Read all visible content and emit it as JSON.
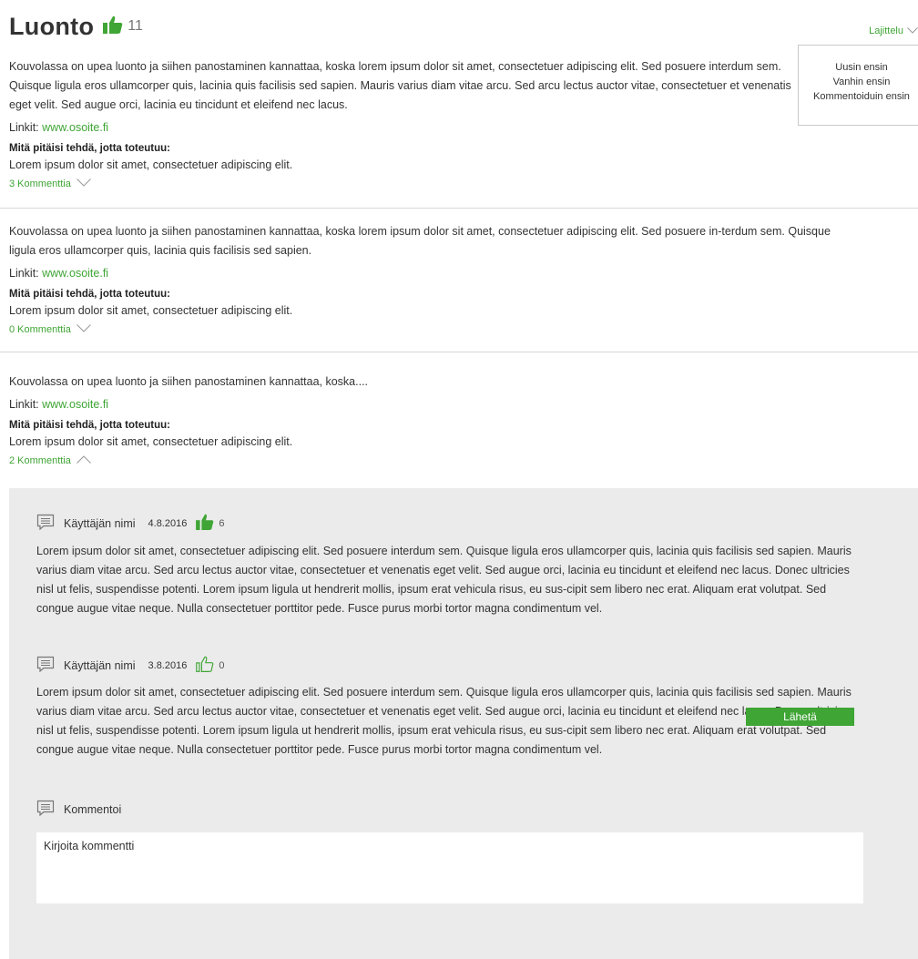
{
  "header": {
    "title": "Luonto",
    "likes": "11"
  },
  "sort": {
    "label": "Lajittelu",
    "options": [
      "Uusin ensin",
      "Vanhin ensin",
      "Kommentoiduin ensin"
    ]
  },
  "posts": [
    {
      "text": "Kouvolassa on upea luonto ja siihen panostaminen kannattaa, koska lorem ipsum dolor sit amet, consectetuer adipiscing elit. Sed posuere interdum sem. Quisque ligula eros ullamcorper quis, lacinia quis facilisis sed sapien. Mauris varius diam vitae arcu. Sed arcu lectus auctor vitae, consectetuer et venenatis eget velit. Sed augue orci, lacinia eu tincidunt et eleifend nec lacus.",
      "links_label": "Linkit:",
      "link": "www.osoite.fi",
      "todo_title": "Mitä pitäisi tehdä, jotta toteutuu:",
      "todo_text": "Lorem ipsum dolor sit amet, consectetuer adipiscing elit.",
      "comments_label": "3 Kommenttia"
    },
    {
      "text": "Kouvolassa on upea luonto ja siihen panostaminen kannattaa, koska lorem ipsum dolor sit amet, consectetuer adipiscing elit. Sed posuere in-terdum sem. Quisque ligula eros ullamcorper quis, lacinia quis facilisis sed sapien.",
      "links_label": "Linkit:",
      "link": "www.osoite.fi",
      "todo_title": "Mitä pitäisi tehdä, jotta toteutuu:",
      "todo_text": "Lorem ipsum dolor sit amet, consectetuer adipiscing elit.",
      "comments_label": "0 Kommenttia"
    },
    {
      "text": "Kouvolassa on upea luonto ja siihen panostaminen kannattaa, koska....",
      "links_label": "Linkit:",
      "link": "www.osoite.fi",
      "todo_title": "Mitä pitäisi tehdä, jotta toteutuu:",
      "todo_text": "Lorem ipsum dolor sit amet, consectetuer adipiscing elit.",
      "comments_label": "2 Kommenttia"
    }
  ],
  "comments": [
    {
      "user": "Käyttäjän nimi",
      "date": "4.8.2016",
      "likes": "6",
      "liked": true,
      "text": "Lorem ipsum dolor sit amet, consectetuer adipiscing elit. Sed posuere interdum sem. Quisque ligula eros ullamcorper quis, lacinia quis facilisis sed sapien. Mauris varius diam vitae arcu. Sed arcu lectus auctor vitae, consectetuer et venenatis eget velit. Sed augue orci, lacinia eu tincidunt et eleifend nec lacus. Donec ultricies nisl ut felis, suspendisse potenti. Lorem ipsum ligula ut hendrerit mollis, ipsum erat vehicula risus, eu sus-cipit sem libero nec erat. Aliquam erat volutpat. Sed congue augue vitae neque. Nulla consectetuer porttitor pede. Fusce purus morbi tortor magna condimentum vel."
    },
    {
      "user": "Käyttäjän nimi",
      "date": "3.8.2016",
      "likes": "0",
      "liked": false,
      "text": "Lorem ipsum dolor sit amet, consectetuer adipiscing elit. Sed posuere interdum sem. Quisque ligula eros ullamcorper quis, lacinia quis facilisis sed sapien. Mauris varius diam vitae arcu. Sed arcu lectus auctor vitae, consectetuer et venenatis eget velit. Sed augue orci, lacinia eu tincidunt et eleifend nec lacus. Donec ultricies nisl ut felis, suspendisse potenti. Lorem ipsum ligula ut hendrerit mollis, ipsum erat vehicula risus, eu sus-cipit sem libero nec erat. Aliquam erat volutpat. Sed congue augue vitae neque. Nulla consectetuer porttitor pede. Fusce purus morbi tortor magna condimentum vel."
    }
  ],
  "reply": {
    "label": "Kommentoi",
    "placeholder": "Kirjoita kommentti",
    "send_label": "Lähetä"
  },
  "colors": {
    "accent": "#3fa535",
    "panel": "#ebebeb"
  }
}
